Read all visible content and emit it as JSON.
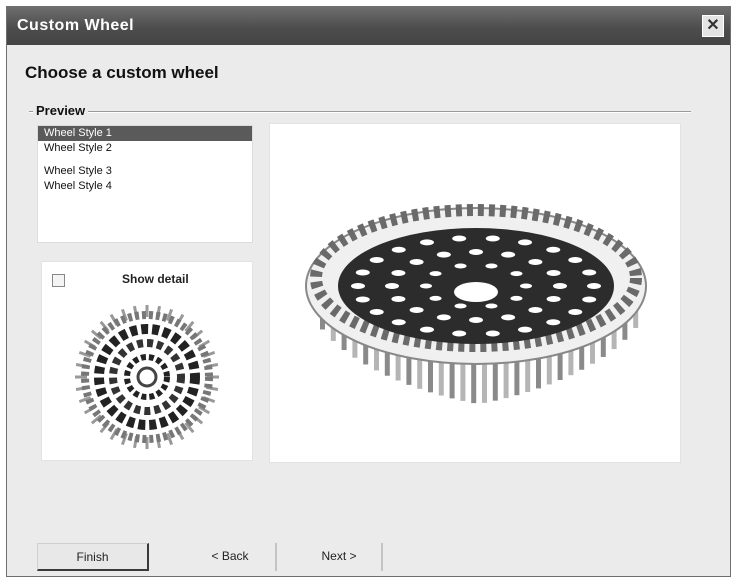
{
  "window": {
    "title": "Custom Wheel",
    "close_glyph": "✕"
  },
  "heading": "Choose a custom wheel",
  "group": {
    "label": "Preview"
  },
  "options": {
    "items": [
      {
        "label": "Wheel Style 1",
        "selected": true
      },
      {
        "label": "Wheel Style 2",
        "selected": false
      },
      {
        "label": "Wheel Style 3",
        "selected": false
      },
      {
        "label": "Wheel Style 4",
        "selected": false
      }
    ]
  },
  "thumbnail": {
    "checkbox_label": "Show detail"
  },
  "buttons": {
    "finish": "Finish",
    "back": "< Back",
    "next": "Next >"
  },
  "colors": {
    "titlebar": "#4d4d4d",
    "dialog_bg": "#ebebeb",
    "selection": "#5a5a5a"
  }
}
